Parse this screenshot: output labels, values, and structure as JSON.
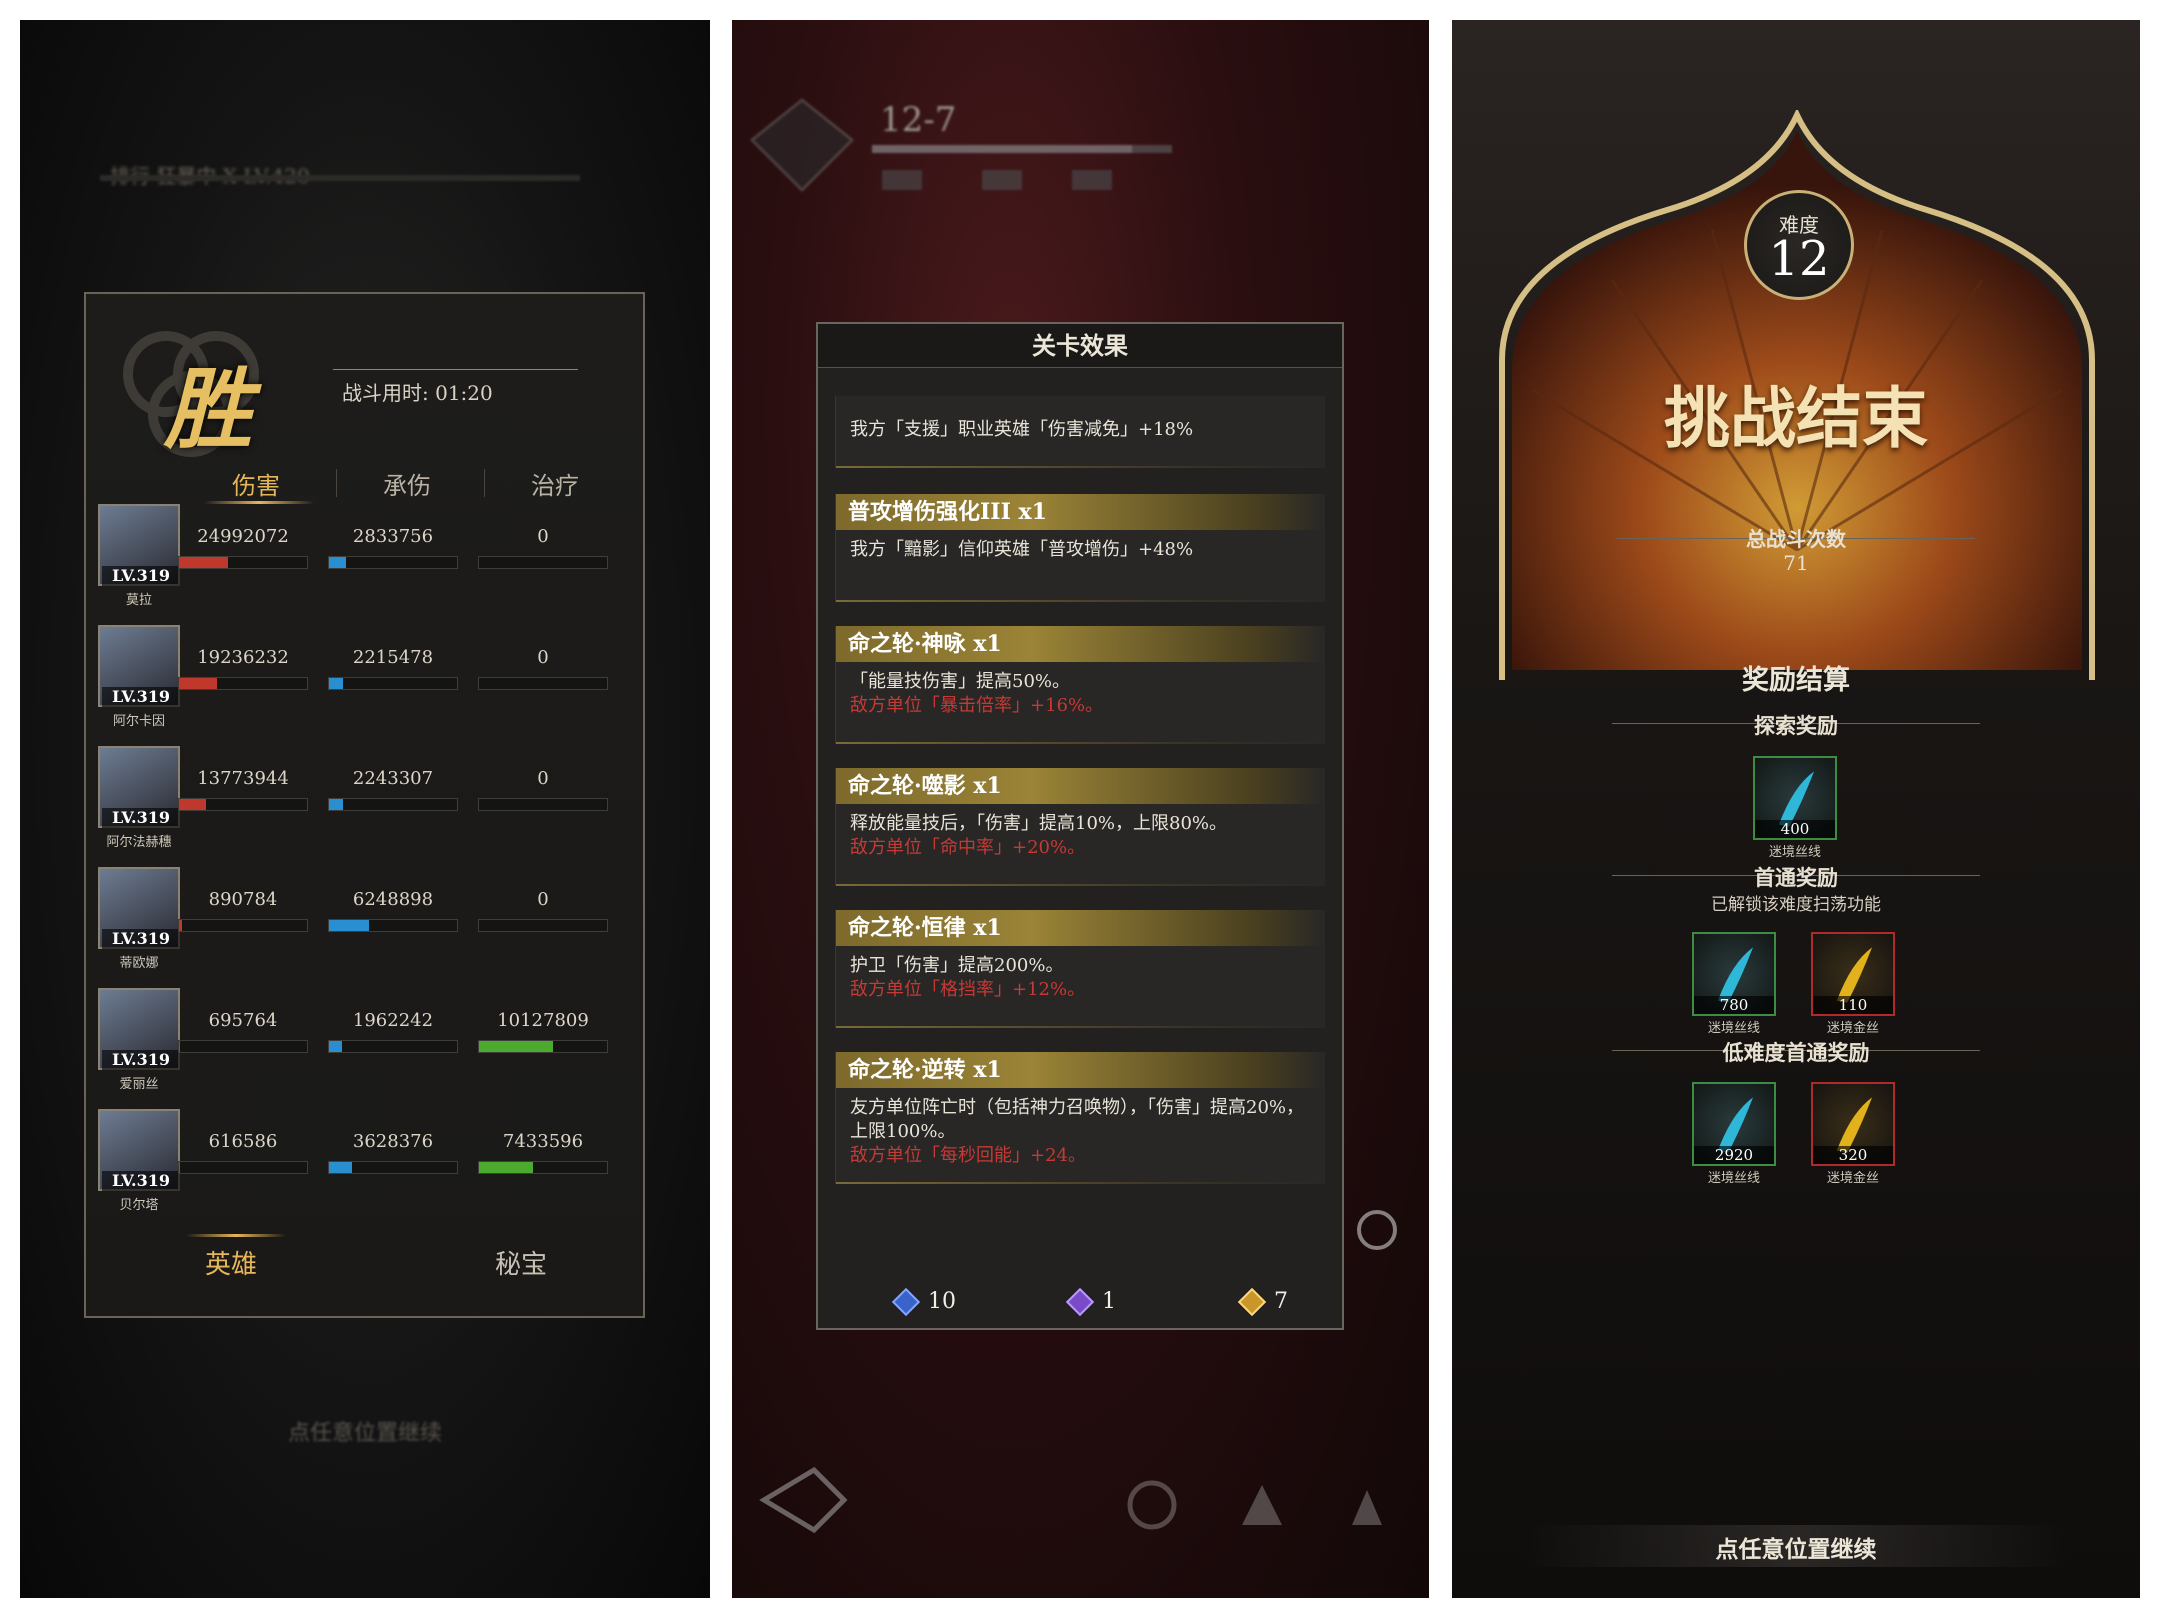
{
  "screen1": {
    "blur_top": "排行  狂暴中 X LV.420",
    "win_char": "胜",
    "battle_time": "战斗用时: 01:20",
    "tabs": [
      "伤害",
      "承伤",
      "治疗"
    ],
    "heroes": [
      {
        "name": "莫拉",
        "level": "LV.319",
        "damage": "24992072",
        "taken": "2833756",
        "heal": "0",
        "dmg_frac": 0.38,
        "taken_frac": 0.13,
        "heal_frac": 0
      },
      {
        "name": "阿尔卡因",
        "level": "LV.319",
        "damage": "19236232",
        "taken": "2215478",
        "heal": "0",
        "dmg_frac": 0.3,
        "taken_frac": 0.11,
        "heal_frac": 0
      },
      {
        "name": "阿尔法赫穗",
        "level": "LV.319",
        "damage": "13773944",
        "taken": "2243307",
        "heal": "0",
        "dmg_frac": 0.21,
        "taken_frac": 0.11,
        "heal_frac": 0
      },
      {
        "name": "蒂欧娜",
        "level": "LV.319",
        "damage": "890784",
        "taken": "6248898",
        "heal": "0",
        "dmg_frac": 0.02,
        "taken_frac": 0.31,
        "heal_frac": 0
      },
      {
        "name": "爱丽丝",
        "level": "LV.319",
        "damage": "695764",
        "taken": "1962242",
        "heal": "10127809",
        "dmg_frac": 0.01,
        "taken_frac": 0.1,
        "heal_frac": 0.58
      },
      {
        "name": "贝尔塔",
        "level": "LV.319",
        "damage": "616586",
        "taken": "3628376",
        "heal": "7433596",
        "dmg_frac": 0.01,
        "taken_frac": 0.18,
        "heal_frac": 0.42
      }
    ],
    "bottom_tabs": [
      "英雄",
      "秘宝"
    ],
    "continue": "点任意位置继续",
    "colors": {
      "accent": "#e6b65a",
      "damage": "#c0372c",
      "taken": "#2a8fd0",
      "heal": "#4caa2e"
    }
  },
  "screen2": {
    "hud_stage": "12-7",
    "title": "关卡效果",
    "effects": [
      {
        "head": "",
        "lines": [
          {
            "text": "我方「支援」职业英雄「伤害减免」+18%",
            "red": false
          }
        ]
      },
      {
        "head": "普攻增伤强化III x1",
        "lines": [
          {
            "text": "我方「黯影」信仰英雄「普攻增伤」+48%",
            "red": false
          }
        ]
      },
      {
        "head": "命之轮·神咏 x1",
        "lines": [
          {
            "text": "「能量技伤害」提高50%。",
            "red": false
          },
          {
            "text": "敌方单位「暴击倍率」+16%。",
            "red": true
          }
        ]
      },
      {
        "head": "命之轮·噬影 x1",
        "lines": [
          {
            "text": "释放能量技后，「伤害」提高10%，上限80%。",
            "red": false
          },
          {
            "text": "敌方单位「命中率」+20%。",
            "red": true
          }
        ]
      },
      {
        "head": "命之轮·恒律 x1",
        "lines": [
          {
            "text": "护卫「伤害」提高200%。",
            "red": false
          },
          {
            "text": "敌方单位「格挡率」+12%。",
            "red": true
          }
        ]
      },
      {
        "head": "命之轮·逆转 x1",
        "lines": [
          {
            "text": "友方单位阵亡时（包括神力召唤物），「伤害」提高20%，上限100%。",
            "red": false
          },
          {
            "text": "敌方单位「每秒回能」+24。",
            "red": true
          }
        ]
      }
    ],
    "counts": [
      {
        "gem": "blue",
        "value": "10",
        "color": "#3a63c9"
      },
      {
        "gem": "purple",
        "value": "1",
        "color": "#7a4ac9"
      },
      {
        "gem": "gold",
        "value": "7",
        "color": "#c9962a"
      }
    ]
  },
  "screen3": {
    "difficulty_label": "难度",
    "difficulty": "12",
    "title": "挑战结束",
    "total_battles_label": "总战斗次数",
    "total_battles": "71",
    "reward_title": "奖励结算",
    "explore": {
      "label": "探索奖励",
      "items": [
        {
          "qty": "400",
          "name": "迷境丝线",
          "kind": "blue"
        }
      ]
    },
    "first_clear": {
      "label": "首通奖励",
      "sub": "已解锁该难度扫荡功能",
      "items": [
        {
          "qty": "780",
          "name": "迷境丝线",
          "kind": "blue"
        },
        {
          "qty": "110",
          "name": "迷境金丝",
          "kind": "gold"
        }
      ]
    },
    "low_first_clear": {
      "label": "低难度首通奖励",
      "items": [
        {
          "qty": "2920",
          "name": "迷境丝线",
          "kind": "blue"
        },
        {
          "qty": "320",
          "name": "迷境金丝",
          "kind": "gold"
        }
      ]
    },
    "continue": "点任意位置继续"
  }
}
